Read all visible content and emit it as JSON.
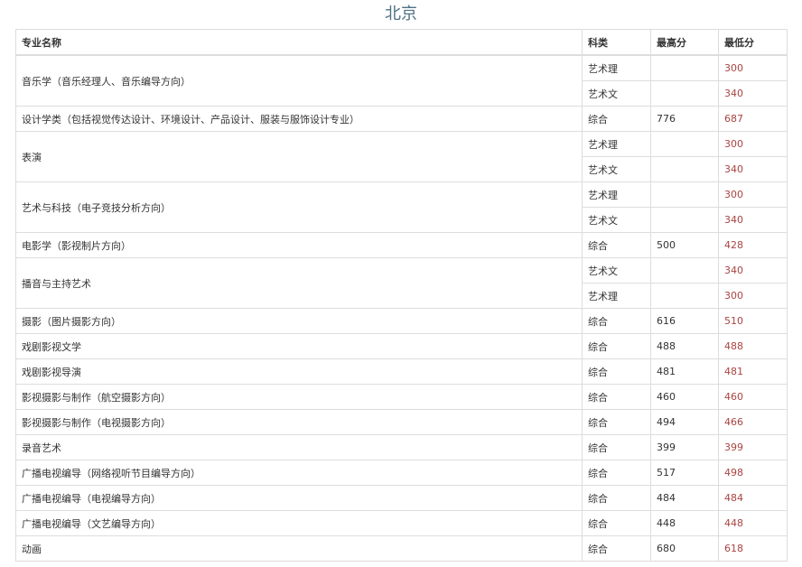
{
  "title": "北京",
  "headers": {
    "major": "专业名称",
    "category": "科类",
    "max": "最高分",
    "min": "最低分"
  },
  "rows": [
    {
      "major": "音乐学（音乐经理人、音乐编导方向）",
      "entries": [
        {
          "category": "艺术理",
          "max": "",
          "min": "300"
        },
        {
          "category": "艺术文",
          "max": "",
          "min": "340"
        }
      ]
    },
    {
      "major": "设计学类（包括视觉传达设计、环境设计、产品设计、服装与服饰设计专业）",
      "entries": [
        {
          "category": "综合",
          "max": "776",
          "min": "687"
        }
      ]
    },
    {
      "major": "表演",
      "entries": [
        {
          "category": "艺术理",
          "max": "",
          "min": "300"
        },
        {
          "category": "艺术文",
          "max": "",
          "min": "340"
        }
      ]
    },
    {
      "major": "艺术与科技（电子竞技分析方向）",
      "entries": [
        {
          "category": "艺术理",
          "max": "",
          "min": "300"
        },
        {
          "category": "艺术文",
          "max": "",
          "min": "340"
        }
      ]
    },
    {
      "major": "电影学（影视制片方向）",
      "entries": [
        {
          "category": "综合",
          "max": "500",
          "min": "428"
        }
      ]
    },
    {
      "major": "播音与主持艺术",
      "entries": [
        {
          "category": "艺术文",
          "max": "",
          "min": "340"
        },
        {
          "category": "艺术理",
          "max": "",
          "min": "300"
        }
      ]
    },
    {
      "major": "摄影（图片摄影方向）",
      "entries": [
        {
          "category": "综合",
          "max": "616",
          "min": "510"
        }
      ]
    },
    {
      "major": "戏剧影视文学",
      "entries": [
        {
          "category": "综合",
          "max": "488",
          "min": "488"
        }
      ]
    },
    {
      "major": "戏剧影视导演",
      "entries": [
        {
          "category": "综合",
          "max": "481",
          "min": "481"
        }
      ]
    },
    {
      "major": "影视摄影与制作（航空摄影方向）",
      "entries": [
        {
          "category": "综合",
          "max": "460",
          "min": "460"
        }
      ]
    },
    {
      "major": "影视摄影与制作（电视摄影方向）",
      "entries": [
        {
          "category": "综合",
          "max": "494",
          "min": "466"
        }
      ]
    },
    {
      "major": "录音艺术",
      "entries": [
        {
          "category": "综合",
          "max": "399",
          "min": "399"
        }
      ]
    },
    {
      "major": "广播电视编导（网络视听节目编导方向）",
      "entries": [
        {
          "category": "综合",
          "max": "517",
          "min": "498"
        }
      ]
    },
    {
      "major": "广播电视编导（电视编导方向）",
      "entries": [
        {
          "category": "综合",
          "max": "484",
          "min": "484"
        }
      ]
    },
    {
      "major": "广播电视编导（文艺编导方向）",
      "entries": [
        {
          "category": "综合",
          "max": "448",
          "min": "448"
        }
      ]
    },
    {
      "major": "动画",
      "entries": [
        {
          "category": "综合",
          "max": "680",
          "min": "618"
        }
      ]
    }
  ]
}
